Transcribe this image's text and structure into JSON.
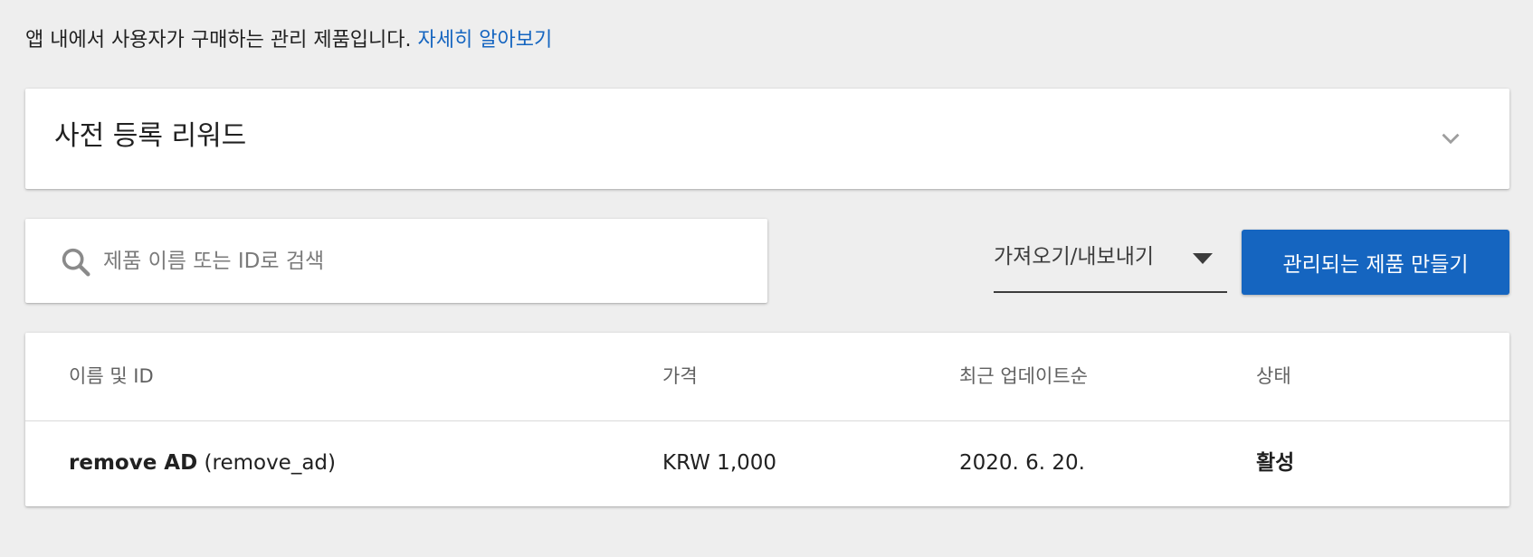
{
  "intro": {
    "text": "앱 내에서 사용자가 구매하는 관리 제품입니다.",
    "link_label": "자세히 알아보기"
  },
  "preregister_section": {
    "title": "사전 등록 리워드",
    "expand_icon": "chevron-down-icon"
  },
  "search": {
    "icon": "search-icon",
    "placeholder": "제품 이름 또는 ID로 검색",
    "value": ""
  },
  "toolbar": {
    "import_export_label": "가져오기/내보내기",
    "import_export_icon": "caret-down-icon",
    "create_button_label": "관리되는 제품 만들기"
  },
  "table": {
    "columns": [
      "이름 및 ID",
      "가격",
      "최근 업데이트순",
      "상태"
    ],
    "rows": [
      {
        "name": "remove AD",
        "id": "(remove_ad)",
        "price": "KRW 1,000",
        "updated": "2020. 6. 20.",
        "status": "활성"
      }
    ]
  },
  "colors": {
    "background": "#eeeeee",
    "card": "#ffffff",
    "accent": "#1565c0",
    "link": "#1565c0",
    "text_primary": "#212121",
    "text_secondary": "#616161"
  }
}
